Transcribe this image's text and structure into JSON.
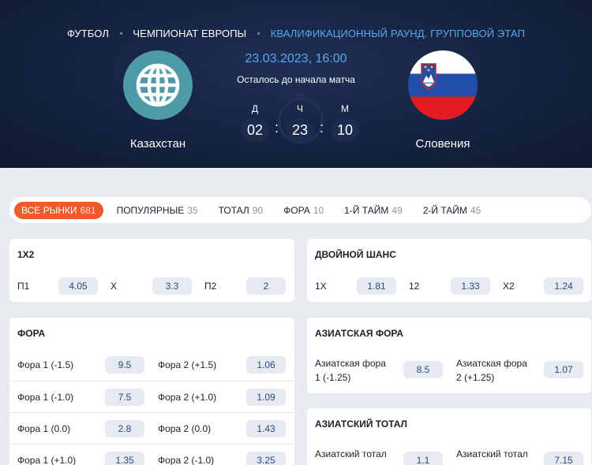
{
  "header": {
    "breadcrumbs": [
      "ФУТБОЛ",
      "ЧЕМПИОНАТ ЕВРОПЫ",
      "КВАЛИФИКАЦИОННЫЙ РАУНД. ГРУППОВОЙ ЭТАП"
    ],
    "date": "23.03.2023, 16:00",
    "countdown_label": "Осталось до начала матча",
    "timer": {
      "days_label": "Д",
      "days": "02",
      "hours_label": "Ч",
      "hours": "23",
      "minutes_label": "М",
      "minutes": "10",
      "sep": ":"
    },
    "home": {
      "name": "Казахстан",
      "icon": "globe-icon"
    },
    "away": {
      "name": "Словения",
      "icon": "slovenia-flag-icon"
    }
  },
  "tabs": [
    {
      "label": "ВСЕ РЫНКИ",
      "count": "681",
      "active": true
    },
    {
      "label": "ПОПУЛЯРНЫЕ",
      "count": "35"
    },
    {
      "label": "ТОТАЛ",
      "count": "90"
    },
    {
      "label": "ФОРА",
      "count": "10"
    },
    {
      "label": "1-Й ТАЙМ",
      "count": "49"
    },
    {
      "label": "2-Й ТАЙМ",
      "count": "45"
    }
  ],
  "markets": {
    "m1x2": {
      "title": "1X2",
      "items": [
        {
          "label": "П1",
          "odd": "4.05"
        },
        {
          "label": "Х",
          "odd": "3.3"
        },
        {
          "label": "П2",
          "odd": "2"
        }
      ]
    },
    "double": {
      "title": "ДВОЙНОЙ ШАНС",
      "items": [
        {
          "label": "1Х",
          "odd": "1.81"
        },
        {
          "label": "12",
          "odd": "1.33"
        },
        {
          "label": "Х2",
          "odd": "1.24"
        }
      ]
    },
    "fora": {
      "title": "ФОРА",
      "rows": [
        [
          {
            "label": "Фора 1 (-1.5)",
            "odd": "9.5"
          },
          {
            "label": "Фора 2 (+1.5)",
            "odd": "1.06"
          }
        ],
        [
          {
            "label": "Фора 1 (-1.0)",
            "odd": "7.5"
          },
          {
            "label": "Фора 2 (+1.0)",
            "odd": "1.09"
          }
        ],
        [
          {
            "label": "Фора 1 (0.0)",
            "odd": "2.8"
          },
          {
            "label": "Фора 2 (0.0)",
            "odd": "1.43"
          }
        ],
        [
          {
            "label": "Фора 1 (+1.0)",
            "odd": "1.35"
          },
          {
            "label": "Фора 2 (-1.0)",
            "odd": "3.25"
          }
        ]
      ]
    },
    "asian_fora": {
      "title": "АЗИАТСКАЯ ФОРА",
      "rows": [
        [
          {
            "label_l1": "Азиатская фора",
            "label_l2": "1 (-1.25)",
            "odd": "8.5"
          },
          {
            "label_l1": "Азиатская фора",
            "label_l2": "2 (+1.25)",
            "odd": "1.07"
          }
        ]
      ]
    },
    "asian_total": {
      "title": "АЗИАТСКИЙ ТОТАЛ",
      "rows": [
        [
          {
            "label_l1": "Азиатский тотал",
            "odd": "1.1"
          },
          {
            "label_l1": "Азиатский тотал",
            "odd": "7.15"
          }
        ]
      ]
    }
  }
}
